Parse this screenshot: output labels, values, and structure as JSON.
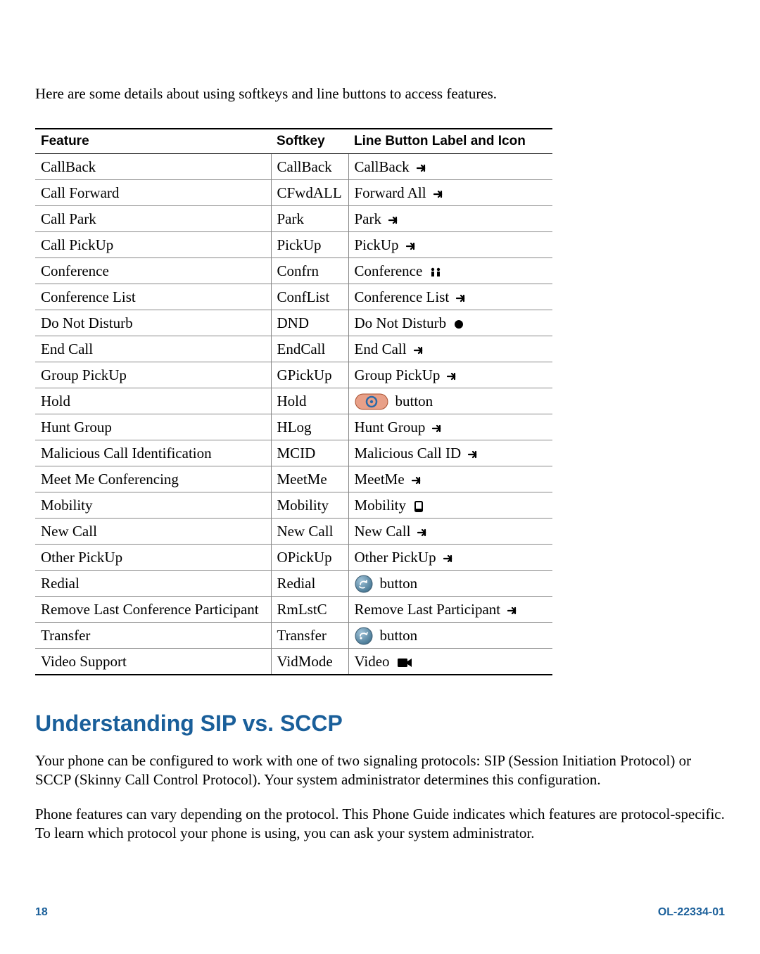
{
  "intro": "Here are some details about using softkeys and line buttons to access features.",
  "table": {
    "headers": {
      "feature": "Feature",
      "softkey": "Softkey",
      "line": "Line Button Label and Icon"
    },
    "rows": [
      {
        "feature": "CallBack",
        "softkey": "CallBack",
        "line_label": "CallBack",
        "icon": "arrow"
      },
      {
        "feature": "Call Forward",
        "softkey": "CFwdALL",
        "line_label": "Forward All",
        "icon": "arrow"
      },
      {
        "feature": "Call Park",
        "softkey": "Park",
        "line_label": "Park",
        "icon": "arrow"
      },
      {
        "feature": "Call PickUp",
        "softkey": "PickUp",
        "line_label": "PickUp",
        "icon": "arrow"
      },
      {
        "feature": "Conference",
        "softkey": "Confrn",
        "line_label": "Conference",
        "icon": "conference"
      },
      {
        "feature": "Conference List",
        "softkey": "ConfList",
        "line_label": "Conference List",
        "icon": "arrow"
      },
      {
        "feature": "Do Not Disturb",
        "softkey": "DND",
        "line_label": "Do Not Disturb",
        "icon": "dnd"
      },
      {
        "feature": "End Call",
        "softkey": "EndCall",
        "line_label": "End Call",
        "icon": "arrow"
      },
      {
        "feature": "Group PickUp",
        "softkey": "GPickUp",
        "line_label": "Group PickUp",
        "icon": "arrow"
      },
      {
        "feature": "Hold",
        "softkey": "Hold",
        "line_label": "button",
        "icon": "hold",
        "icon_first": true
      },
      {
        "feature": "Hunt Group",
        "softkey": "HLog",
        "line_label": "Hunt Group",
        "icon": "arrow"
      },
      {
        "feature": "Malicious Call Identification",
        "softkey": "MCID",
        "line_label": "Malicious Call ID",
        "icon": "arrow"
      },
      {
        "feature": "Meet Me Conferencing",
        "softkey": "MeetMe",
        "line_label": "MeetMe",
        "icon": "arrow"
      },
      {
        "feature": "Mobility",
        "softkey": "Mobility",
        "line_label": "Mobility",
        "icon": "mobility"
      },
      {
        "feature": "New Call",
        "softkey": "New Call",
        "line_label": "New Call",
        "icon": "arrow"
      },
      {
        "feature": "Other PickUp",
        "softkey": "OPickUp",
        "line_label": "Other PickUp",
        "icon": "arrow"
      },
      {
        "feature": "Redial",
        "softkey": "Redial",
        "line_label": "button",
        "icon": "redial",
        "icon_first": true
      },
      {
        "feature": "Remove Last Conference Participant",
        "softkey": "RmLstC",
        "line_label": "Remove Last Participant",
        "icon": "arrow"
      },
      {
        "feature": "Transfer",
        "softkey": "Transfer",
        "line_label": "button",
        "icon": "transfer",
        "icon_first": true
      },
      {
        "feature": "Video Support",
        "softkey": "VidMode",
        "line_label": "Video",
        "icon": "video"
      }
    ]
  },
  "section_heading": "Understanding SIP vs. SCCP",
  "para1": "Your phone can be configured to work with one of two signaling protocols: SIP (Session Initiation Protocol) or SCCP (Skinny Call Control Protocol). Your system administrator determines this configuration.",
  "para2": "Phone features can vary depending on the protocol. This Phone Guide indicates which features are protocol-specific. To learn which protocol your phone is using, you can ask your system administrator.",
  "footer": {
    "page": "18",
    "doc": "OL-22334-01"
  },
  "icons": {
    "arrow": "arrow-icon",
    "conference": "conference-icon",
    "dnd": "dnd-icon",
    "hold": "hold-button-icon",
    "mobility": "mobility-icon",
    "redial": "redial-button-icon",
    "transfer": "transfer-button-icon",
    "video": "video-icon"
  }
}
